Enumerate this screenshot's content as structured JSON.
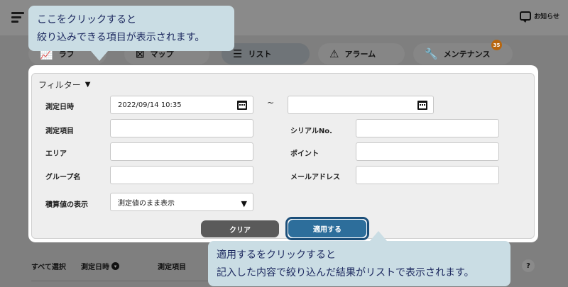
{
  "header": {
    "notice_label": "お知らせ"
  },
  "tabs": [
    {
      "label": "ラフ",
      "icon": "graph-icon"
    },
    {
      "label": "マップ",
      "icon": "map-icon"
    },
    {
      "label": "リスト",
      "icon": "list-icon",
      "active": true
    },
    {
      "label": "アラーム",
      "icon": "alarm-icon"
    },
    {
      "label": "メンテナンス",
      "icon": "maintenance-icon",
      "badge": "35"
    }
  ],
  "filter": {
    "title": "フィルター",
    "date_label": "測定日時",
    "date_from": "2022/09/14 10:35",
    "date_to": "",
    "range_separator": "~",
    "item_label": "測定項目",
    "item_value": "",
    "serial_label": "シリアルNo.",
    "serial_value": "",
    "area_label": "エリア",
    "area_value": "",
    "point_label": "ポイント",
    "point_value": "",
    "group_label": "グループ名",
    "group_value": "",
    "email_label": "メールアドレス",
    "email_value": "",
    "integral_label": "積算値の表示",
    "integral_selected": "測定値のまま表示",
    "clear_label": "クリア",
    "apply_label": "適用する"
  },
  "list": {
    "select_all": "すべて選択",
    "col_datetime": "測定日時",
    "col_item": "測定項目",
    "help": "?"
  },
  "callouts": {
    "top_line1": "ここをクリックすると",
    "top_line2": "絞り込みできる項目が表示されます。",
    "bottom_line1": "適用するをクリックすると",
    "bottom_line2": "記入した内容で絞り込んだ結果がリストで表示されます。"
  },
  "colors": {
    "apply_button": "#2d6e9b",
    "clear_button": "#5a5a5a",
    "callout_bg": "#cadde4",
    "callout_text": "#1e2a60",
    "badge": "#b8660e"
  }
}
